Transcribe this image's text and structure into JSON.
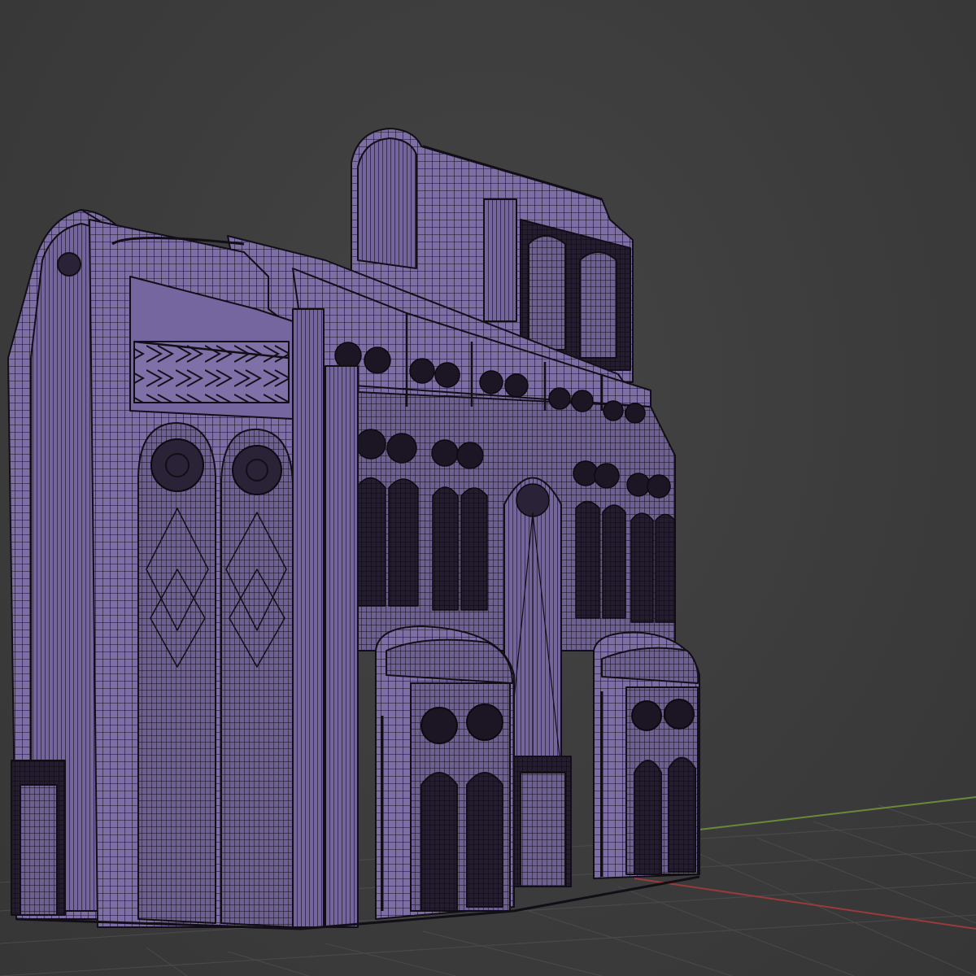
{
  "viewport": {
    "type": "3d-viewport",
    "view": "perspective",
    "shading": "solid-wireframe-overlay",
    "background_color": "#3d3d3d",
    "grid_color": "#4a4a4a",
    "x_axis_color": "#9b3a3a",
    "y_axis_color": "#6a8a3a",
    "model_color": "#7a6aa0",
    "wire_color": "#141018",
    "grid_visible": true
  },
  "object": {
    "kind": "mesh",
    "subject": "gothic-cathedral-facade"
  }
}
